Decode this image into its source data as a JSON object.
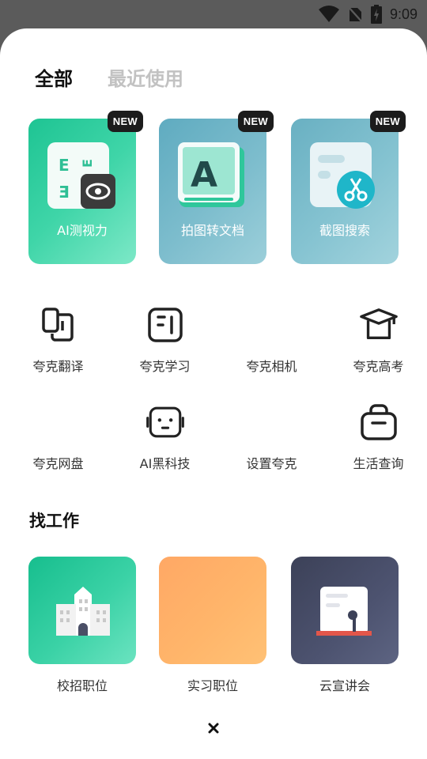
{
  "status_bar": {
    "time": "9:09"
  },
  "tabs": [
    {
      "label": "全部",
      "active": true
    },
    {
      "label": "最近使用",
      "active": false
    }
  ],
  "featured": [
    {
      "label": "AI测视力",
      "badge": "NEW",
      "icon": "eye-chart-icon",
      "color": "#2fd0a2"
    },
    {
      "label": "拍图转文档",
      "badge": "NEW",
      "icon": "letter-a-document-icon",
      "color": "#6fb3c6"
    },
    {
      "label": "截图搜索",
      "badge": "NEW",
      "icon": "scissors-search-icon",
      "color": "#7ab9c8"
    }
  ],
  "tools_row1": [
    {
      "label": "夸克翻译",
      "icon": "translate-icon"
    },
    {
      "label": "夸克学习",
      "icon": "study-icon"
    },
    {
      "label": "夸克相机",
      "icon": "camera-icon"
    },
    {
      "label": "夸克高考",
      "icon": "graduation-cap-icon"
    }
  ],
  "tools_row2": [
    {
      "label": "夸克网盘",
      "icon": "cloud-drive-icon"
    },
    {
      "label": "AI黑科技",
      "icon": "robot-face-icon"
    },
    {
      "label": "设置夸克",
      "icon": "settings-icon"
    },
    {
      "label": "生活查询",
      "icon": "bag-icon"
    }
  ],
  "jobs_section": {
    "title": "找工作",
    "items": [
      {
        "label": "校招职位",
        "icon": "school-building-icon",
        "color": "#2fc79b"
      },
      {
        "label": "实习职位",
        "icon": "internship-icon",
        "color": "#ffb060"
      },
      {
        "label": "云宣讲会",
        "icon": "lecture-board-icon",
        "color": "#4a4f66"
      }
    ]
  }
}
